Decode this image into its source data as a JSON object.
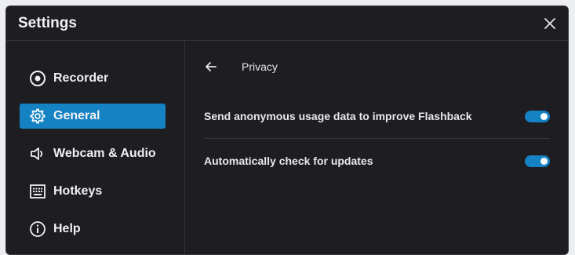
{
  "window": {
    "title": "Settings"
  },
  "sidebar": {
    "items": [
      {
        "label": "Recorder",
        "icon": "record-icon",
        "active": false
      },
      {
        "label": "General",
        "icon": "gear-icon",
        "active": true
      },
      {
        "label": "Webcam & Audio",
        "icon": "speaker-icon",
        "active": false
      },
      {
        "label": "Hotkeys",
        "icon": "keyboard-icon",
        "active": false
      },
      {
        "label": "Help",
        "icon": "info-icon",
        "active": false
      }
    ]
  },
  "content": {
    "section_title": "Privacy",
    "settings": [
      {
        "label": "Send anonymous usage data to improve Flashback",
        "enabled": true
      },
      {
        "label": "Automatically check for updates",
        "enabled": true
      }
    ]
  },
  "colors": {
    "accent": "#1582c4",
    "background": "#1d1d22",
    "divider": "#34343a",
    "text": "#f0f0f2"
  }
}
